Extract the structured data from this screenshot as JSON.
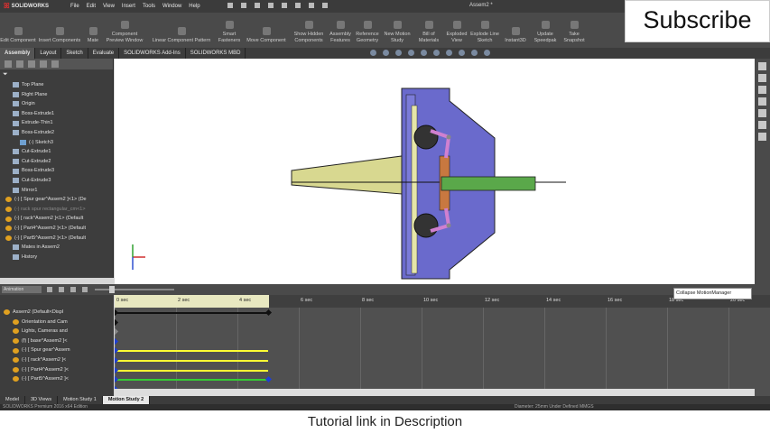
{
  "app": {
    "brand": "SOLIDWORKS",
    "document_title": "Assem2 *",
    "menu": [
      "File",
      "Edit",
      "View",
      "Insert",
      "Tools",
      "Window",
      "Help"
    ]
  },
  "command_manager": [
    {
      "label": "Edit Component"
    },
    {
      "label": "Insert Components"
    },
    {
      "label": "Mate"
    },
    {
      "label": "Component Preview Window"
    },
    {
      "label": "Linear Component Pattern"
    },
    {
      "label": "Smart Fasteners"
    },
    {
      "label": "Move Component"
    },
    {
      "label": "Show Hidden Components"
    },
    {
      "label": "Assembly Features"
    },
    {
      "label": "Reference Geometry"
    },
    {
      "label": "New Motion Study"
    },
    {
      "label": "Bill of Materials"
    },
    {
      "label": "Exploded View"
    },
    {
      "label": "Explode Line Sketch"
    },
    {
      "label": "Instant3D"
    },
    {
      "label": "Update Speedpak"
    },
    {
      "label": "Take Snapshot"
    }
  ],
  "tabs": [
    "Assembly",
    "Layout",
    "Sketch",
    "Evaluate",
    "SOLIDWORKS Add-Ins",
    "SOLIDWORKS MBD"
  ],
  "feature_tree": [
    {
      "label": "Top Plane",
      "kind": "plane",
      "indent": 1
    },
    {
      "label": "Right Plane",
      "kind": "plane",
      "indent": 1
    },
    {
      "label": "Origin",
      "kind": "plane",
      "indent": 1
    },
    {
      "label": "Boss-Extrude1",
      "kind": "feature",
      "indent": 1
    },
    {
      "label": "Extrude-Thin1",
      "kind": "feature",
      "indent": 1
    },
    {
      "label": "Boss-Extrude2",
      "kind": "feature",
      "indent": 1
    },
    {
      "label": "(-) Sketch3",
      "kind": "sketch",
      "indent": 2
    },
    {
      "label": "Cut-Extrude1",
      "kind": "feature",
      "indent": 1
    },
    {
      "label": "Cut-Extrude2",
      "kind": "feature",
      "indent": 1
    },
    {
      "label": "Boss-Extrude3",
      "kind": "feature",
      "indent": 1
    },
    {
      "label": "Cut-Extrude3",
      "kind": "feature",
      "indent": 1
    },
    {
      "label": "Mirror1",
      "kind": "feature",
      "indent": 1
    },
    {
      "label": "(-) [ Spur gear^Assem2 ]<1> (De",
      "kind": "gear",
      "indent": 0
    },
    {
      "label": "(-) rack spur rectangular_cm<1>",
      "kind": "gear",
      "indent": 0,
      "dim": true
    },
    {
      "label": "(-) [ rack^Assem2 ]<1> (Default",
      "kind": "gear",
      "indent": 0
    },
    {
      "label": "(-) [ Part4^Assem2 ]<1> (Default",
      "kind": "gear",
      "indent": 0
    },
    {
      "label": "(-) [ Part5^Assem2 ]<1> (Default",
      "kind": "gear",
      "indent": 0
    },
    {
      "label": "Mates in Assem2",
      "kind": "feature",
      "indent": 1
    },
    {
      "label": "History",
      "kind": "feature",
      "indent": 1
    }
  ],
  "motion": {
    "study_type": "Animation",
    "collapse_tooltip": "Collapse MotionManager",
    "tree": [
      "Assem2 (Default<Displ",
      "Orientation and Cam",
      "Lights, Cameras and",
      "(f) [ base^Assem2 ]<",
      "(-) [ Spur gear^Assem",
      "(-) [ rack^Assem2 ]<",
      "(-) [ Part4^Assem2 ]<",
      "(-) [ Part5^Assem2 ]<"
    ],
    "ticks": [
      "0 sec",
      "2 sec",
      "4 sec",
      "6 sec",
      "8 sec",
      "10 sec",
      "12 sec",
      "14 sec",
      "16 sec",
      "18 sec",
      "20 sec"
    ]
  },
  "bottom_tabs": [
    "Model",
    "3D Views",
    "Motion Study 1",
    "Motion Study 2"
  ],
  "status": {
    "left": "SOLIDWORKS Premium 2016 x64 Edition",
    "right": "Diameter: 25mm   Under Defined   MMGS"
  },
  "overlay": {
    "subscribe": "Subscribe",
    "caption": "Tutorial link in Description"
  },
  "colors": {
    "body_fill": "#6666cc",
    "cone_fill": "#d8d890",
    "shaft_fill": "#5aa84a",
    "rack_fill": "#c87840",
    "link_fill": "#d080d0",
    "timeline_yellow": "#ffff33",
    "timeline_green": "#33cc33"
  }
}
